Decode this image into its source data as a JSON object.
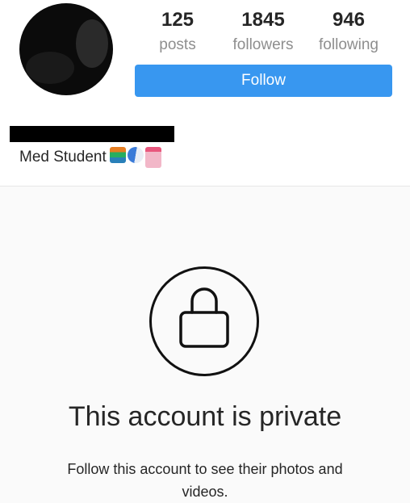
{
  "profile": {
    "bio": "Med Student"
  },
  "stats": [
    {
      "value": "125",
      "label": "posts"
    },
    {
      "value": "1845",
      "label": "followers"
    },
    {
      "value": "946",
      "label": "following"
    }
  ],
  "actions": {
    "follow_label": "Follow"
  },
  "private_notice": {
    "title": "This account is private",
    "subtitle": "Follow this account to see their photos and videos."
  },
  "colors": {
    "accent": "#3897f0",
    "muted_text": "#8e8e8e",
    "private_bg": "#fafafa"
  },
  "icons": [
    "books-emoji",
    "pill-emoji",
    "hospital-emoji",
    "lock-icon"
  ]
}
